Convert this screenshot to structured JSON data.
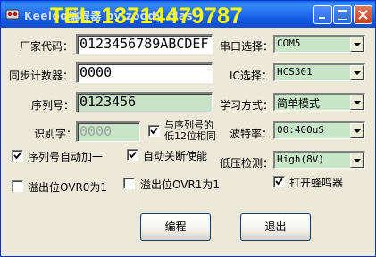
{
  "window": {
    "title": "Keeloq编程器 by zoody clas",
    "watermark": "TEL:13714479787"
  },
  "fields": {
    "factory_code": {
      "label": "厂家代码：",
      "value": "0123456789ABCDEF"
    },
    "sync_counter": {
      "label": "同步计数器：",
      "value": "0000"
    },
    "serial": {
      "label": "序列号：",
      "value": "0123456"
    },
    "identifier": {
      "label": "识别字：",
      "value": "0000"
    }
  },
  "same_low12": {
    "line1": "与序列号的",
    "line2": "低12位相同"
  },
  "checkboxes": {
    "serial_auto_inc": "序列号自动加一",
    "auto_disable": "自动关断使能",
    "ovr0": "溢出位OVR0为1",
    "ovr1": "溢出位OVR1为1",
    "buzzer": "打开蜂鸣器"
  },
  "selects": {
    "port": {
      "label": "串口选择：",
      "value": "COM5"
    },
    "ic": {
      "label": "IC选择：",
      "value": "HCS301"
    },
    "mode": {
      "label": "学习方式：",
      "value": "简单模式"
    },
    "baud": {
      "label": "波特率：",
      "value": "00:400uS"
    },
    "lowvolt": {
      "label": "低压检测：",
      "value": "High(8V)"
    }
  },
  "buttons": {
    "program": "编程",
    "exit": "退出"
  }
}
